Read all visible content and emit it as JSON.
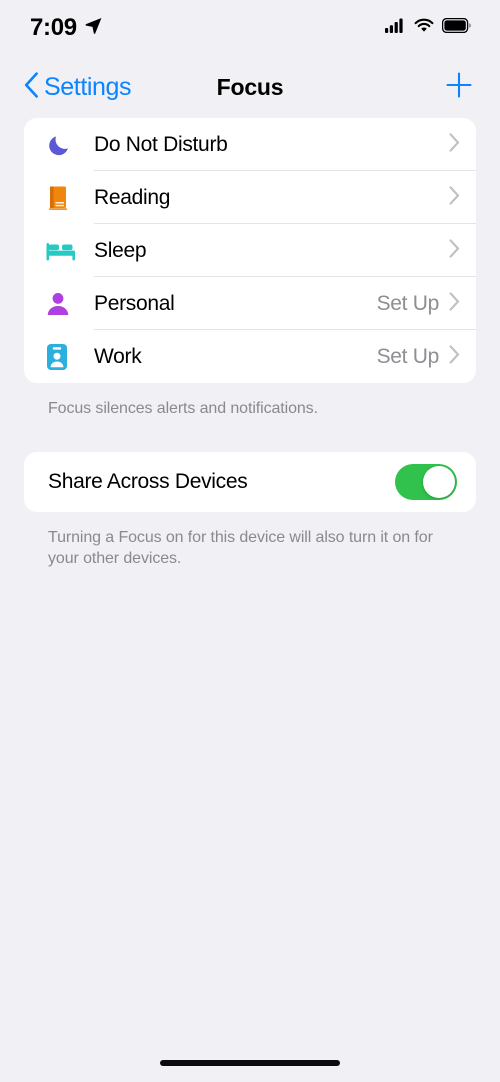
{
  "status_bar": {
    "time": "7:09",
    "location_icon": "location-arrow-icon",
    "cellular_icon": "cellular-signal-icon",
    "cellular_bars": 4,
    "wifi_icon": "wifi-icon",
    "battery_icon": "battery-full-icon"
  },
  "nav": {
    "back_label": "Settings",
    "back_icon": "chevron-left-icon",
    "title": "Focus",
    "add_icon": "plus-icon",
    "accent_color": "#0A84FF"
  },
  "focus_list": {
    "items": [
      {
        "label": "Do Not Disturb",
        "value": "",
        "icon": "moon-icon",
        "icon_color": "#5A58D6"
      },
      {
        "label": "Reading",
        "value": "",
        "icon": "book-icon",
        "icon_color": "#F0860E"
      },
      {
        "label": "Sleep",
        "value": "",
        "icon": "bed-icon",
        "icon_color": "#26C9C3"
      },
      {
        "label": "Personal",
        "value": "Set Up",
        "icon": "person-icon",
        "icon_color": "#B03FE0"
      },
      {
        "label": "Work",
        "value": "Set Up",
        "icon": "id-badge-icon",
        "icon_color": "#2BB0DE"
      }
    ],
    "footer": "Focus silences alerts and notifications."
  },
  "share_section": {
    "label": "Share Across Devices",
    "toggle_on": true,
    "toggle_on_color": "#30C24D",
    "footer": "Turning a Focus on for this device will also turn it on for your other devices."
  },
  "home_indicator": "home-indicator"
}
